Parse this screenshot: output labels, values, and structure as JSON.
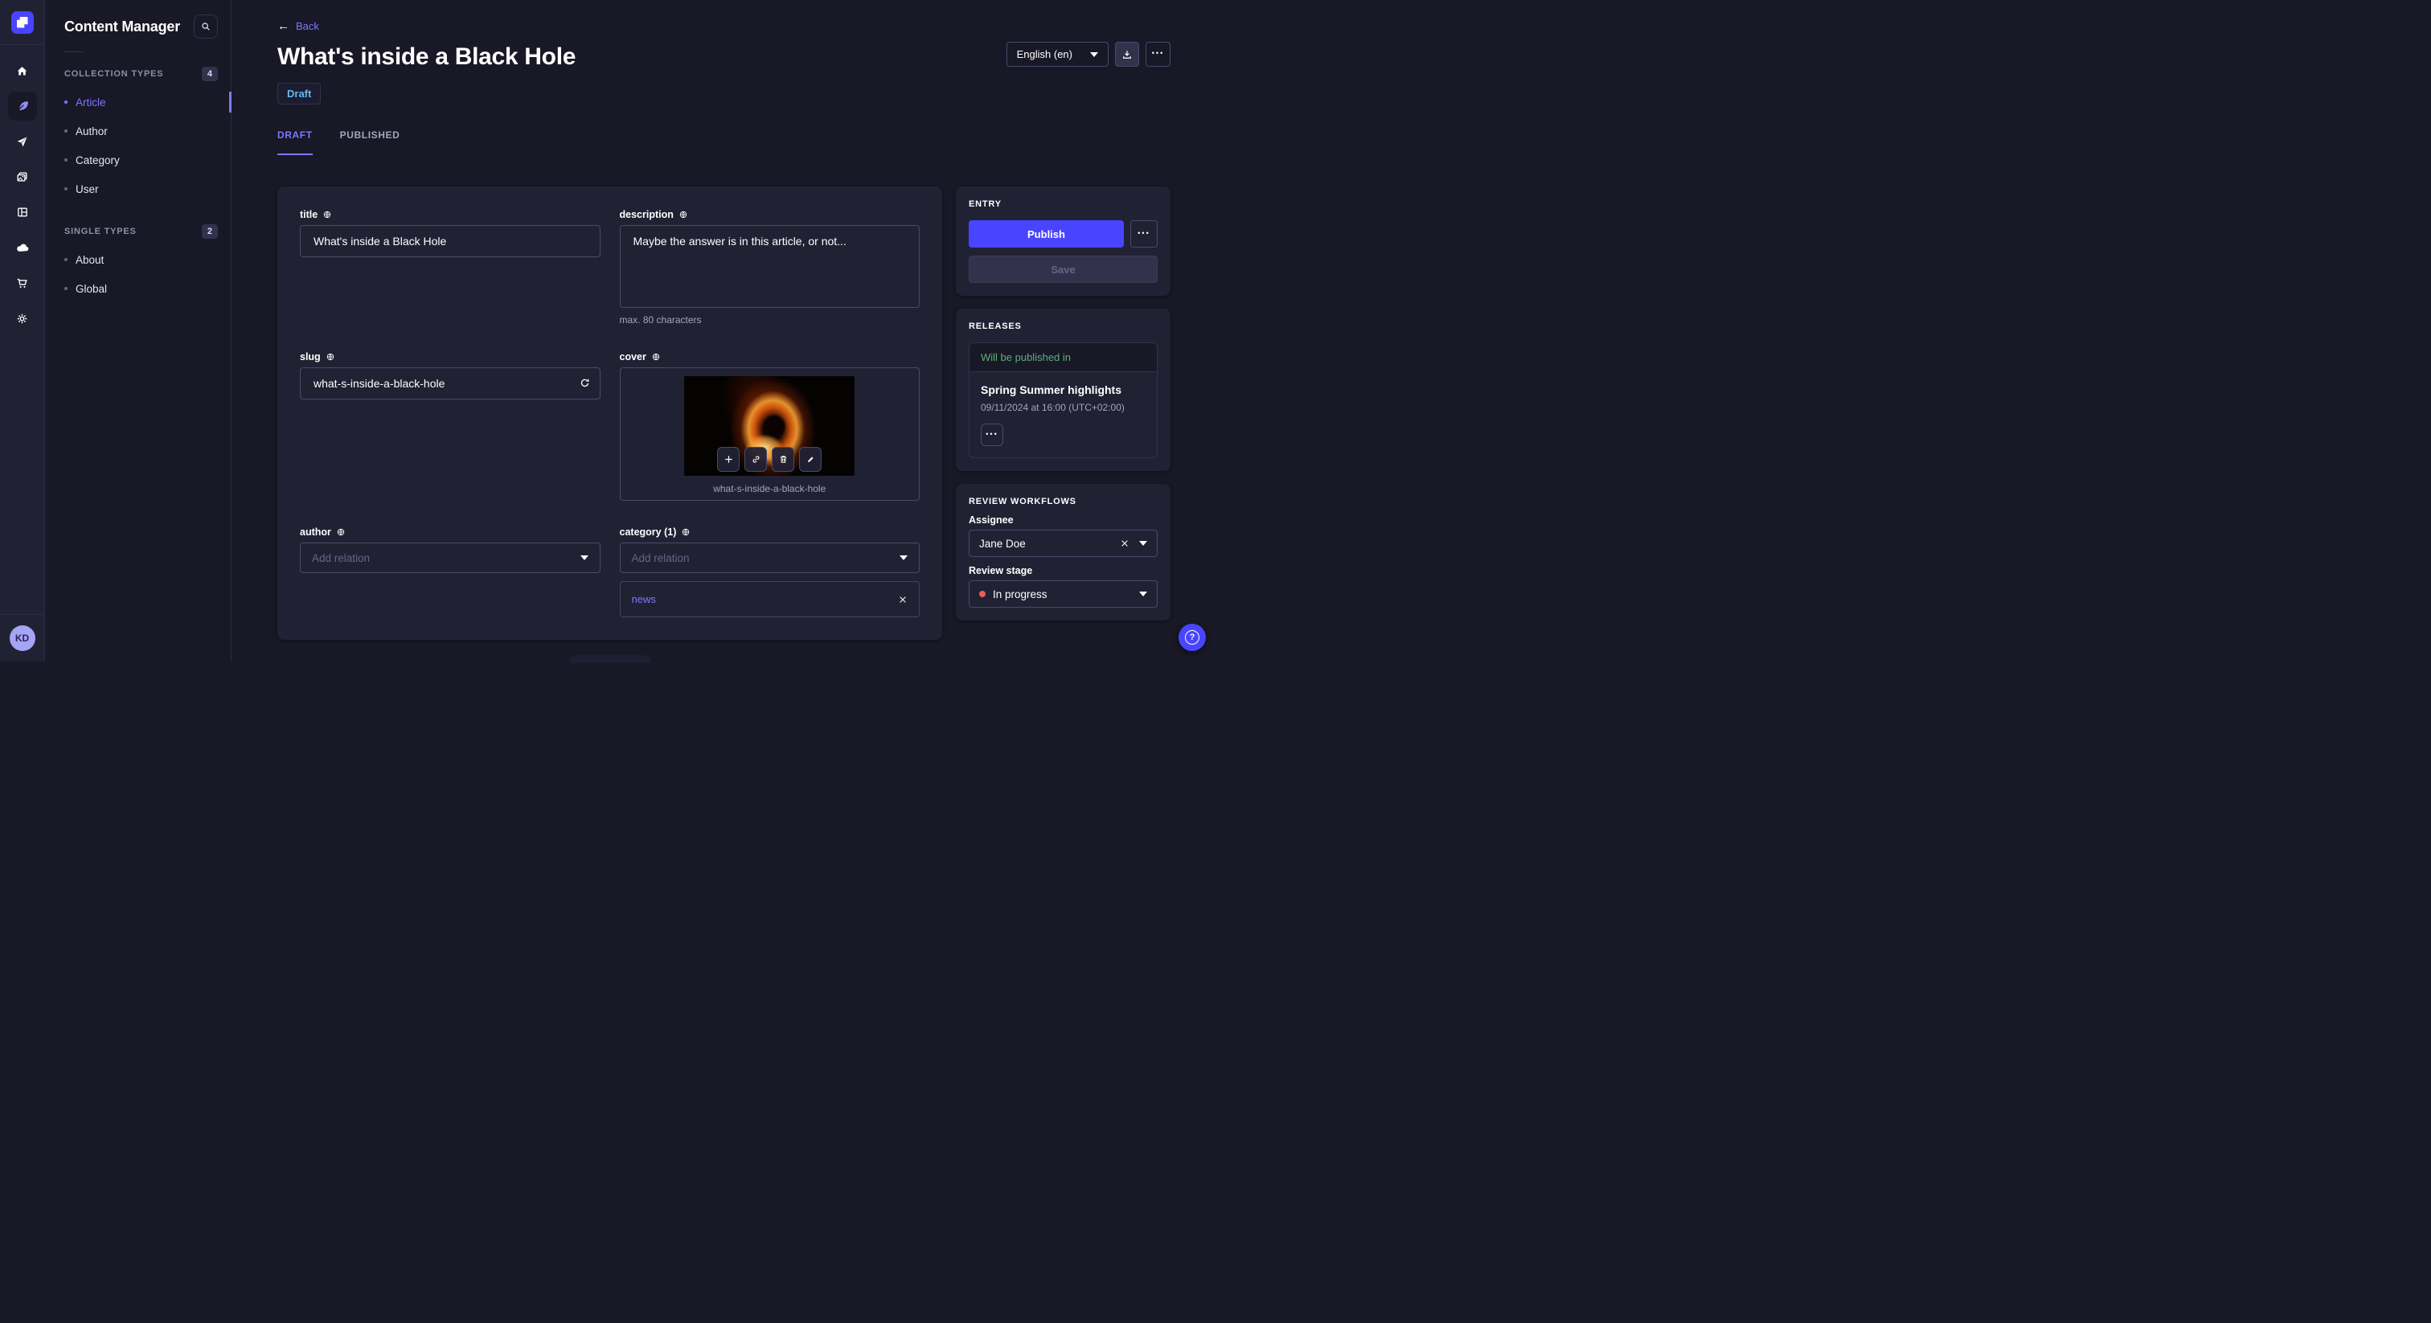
{
  "subnav": {
    "title": "Content Manager",
    "sections": [
      {
        "label": "COLLECTION TYPES",
        "count": "4",
        "items": [
          {
            "label": "Article"
          },
          {
            "label": "Author"
          },
          {
            "label": "Category"
          },
          {
            "label": "User"
          }
        ]
      },
      {
        "label": "SINGLE TYPES",
        "count": "2",
        "items": [
          {
            "label": "About"
          },
          {
            "label": "Global"
          }
        ]
      }
    ]
  },
  "nav_icons": [
    "home-icon",
    "feather-icon",
    "paper-plane-icon",
    "media-library-icon",
    "layout-icon",
    "cloud-icon",
    "cart-icon",
    "gear-icon"
  ],
  "user": {
    "initials": "KD"
  },
  "header": {
    "back_label": "Back",
    "title": "What's inside a Black Hole",
    "status": "Draft",
    "locale": "English (en)",
    "tabs": [
      {
        "label": "DRAFT"
      },
      {
        "label": "PUBLISHED"
      }
    ]
  },
  "form": {
    "title": {
      "label": "title",
      "value": "What's inside a Black Hole"
    },
    "description": {
      "label": "description",
      "value": "Maybe the answer is in this article, or not...",
      "hint": "max. 80 characters"
    },
    "slug": {
      "label": "slug",
      "value": "what-s-inside-a-black-hole"
    },
    "cover": {
      "label": "cover",
      "filename": "what-s-inside-a-black-hole"
    },
    "author": {
      "label": "author",
      "placeholder": "Add relation"
    },
    "category": {
      "label": "category (1)",
      "placeholder": "Add relation",
      "selected": "news"
    }
  },
  "entry": {
    "heading": "ENTRY",
    "publish_label": "Publish",
    "save_label": "Save"
  },
  "releases": {
    "heading": "RELEASES",
    "status": "Will be published in",
    "release_name": "Spring Summer highlights",
    "release_date": "09/11/2024 at 16:00 (UTC+02:00)"
  },
  "review": {
    "heading": "REVIEW WORKFLOWS",
    "assignee_label": "Assignee",
    "assignee_value": "Jane Doe",
    "stage_label": "Review stage",
    "stage_value": "In progress"
  },
  "colors": {
    "primary": "#4945ff",
    "link": "#7b79ff",
    "draft": "#66b7f1",
    "success": "#5cb176",
    "stage_dot": "#ee5e52"
  }
}
